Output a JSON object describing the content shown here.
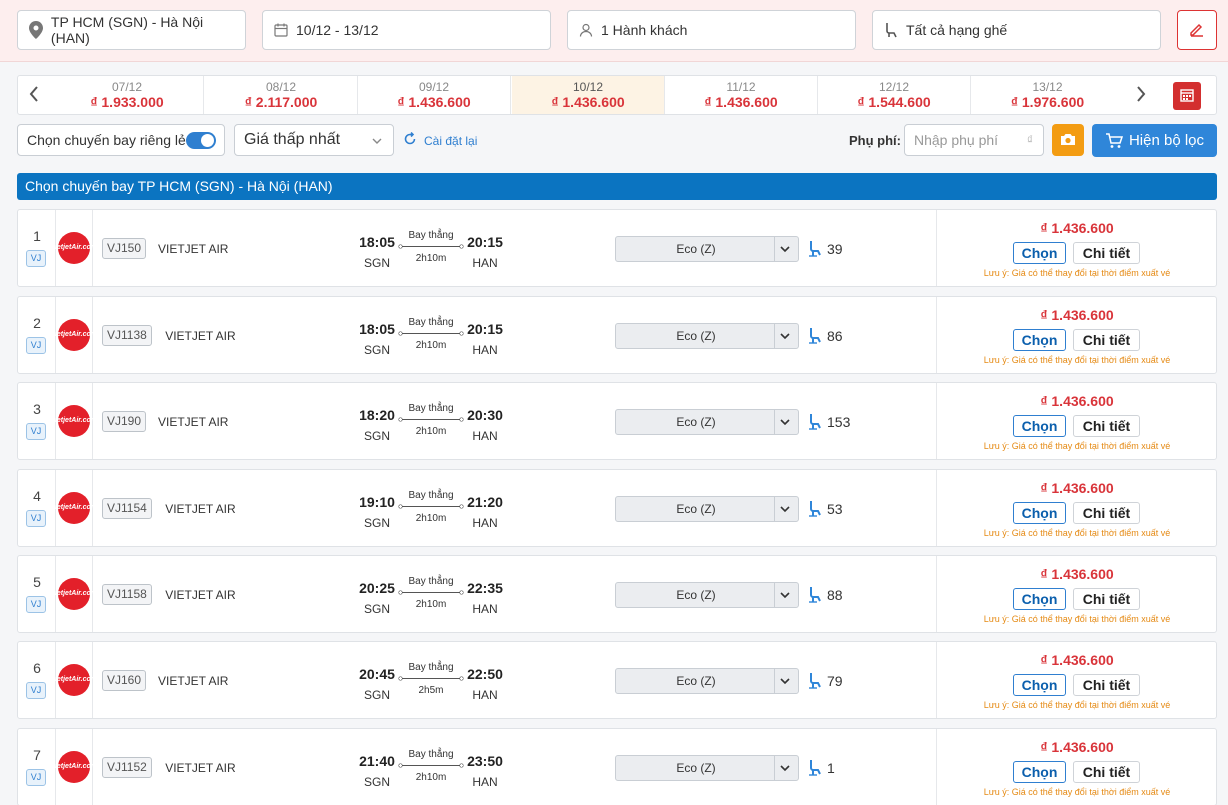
{
  "search": {
    "route": "TP HCM (SGN) - Hà Nội (HAN)",
    "dates": "10/12 - 13/12",
    "passengers": "1 Hành khách",
    "seat_class": "Tất cả hạng ghế"
  },
  "date_strip": [
    {
      "date": "07/12",
      "price": "₫ 1.933.000",
      "active": false
    },
    {
      "date": "08/12",
      "price": "₫ 2.117.000",
      "active": false
    },
    {
      "date": "09/12",
      "price": "₫ 1.436.600",
      "active": false
    },
    {
      "date": "10/12",
      "price": "₫ 1.436.600",
      "active": true
    },
    {
      "date": "11/12",
      "price": "₫ 1.436.600",
      "active": false
    },
    {
      "date": "12/12",
      "price": "₫ 1.544.600",
      "active": false
    },
    {
      "date": "13/12",
      "price": "₫ 1.976.600",
      "active": false
    }
  ],
  "filters": {
    "toggle_label": "Chọn chuyến bay riêng lẻ",
    "toggle_on": true,
    "sort_label": "Giá thấp nhất",
    "reset_label": "Cài đặt lại",
    "fee_label": "Phụ phí:",
    "fee_placeholder": "Nhập phụ phí",
    "fee_currency": "₫",
    "filter_button": "Hiện bộ lọc"
  },
  "section_title": "Chọn chuyến bay TP HCM (SGN) - Hà Nội (HAN)",
  "common": {
    "airline_badge": "VJ",
    "logo_text_1": "vietjet",
    "logo_text_2": "Air.com",
    "airline_name": "VIETJET AIR",
    "direct_label": "Bay thẳng",
    "from_code": "SGN",
    "to_code": "HAN",
    "class_label": "Eco  (Z)",
    "select_label": "Chọn",
    "detail_label": "Chi tiết",
    "note": "Lưu ý: Giá có thể thay đổi tại thời điểm xuất vé"
  },
  "flights": [
    {
      "index": "1",
      "code": "VJ150",
      "dep": "18:05",
      "arr": "20:15",
      "duration": "2h10m",
      "seats": "39",
      "price": "₫ 1.436.600"
    },
    {
      "index": "2",
      "code": "VJ1138",
      "dep": "18:05",
      "arr": "20:15",
      "duration": "2h10m",
      "seats": "86",
      "price": "₫ 1.436.600"
    },
    {
      "index": "3",
      "code": "VJ190",
      "dep": "18:20",
      "arr": "20:30",
      "duration": "2h10m",
      "seats": "153",
      "price": "₫ 1.436.600"
    },
    {
      "index": "4",
      "code": "VJ1154",
      "dep": "19:10",
      "arr": "21:20",
      "duration": "2h10m",
      "seats": "53",
      "price": "₫ 1.436.600"
    },
    {
      "index": "5",
      "code": "VJ1158",
      "dep": "20:25",
      "arr": "22:35",
      "duration": "2h10m",
      "seats": "88",
      "price": "₫ 1.436.600"
    },
    {
      "index": "6",
      "code": "VJ160",
      "dep": "20:45",
      "arr": "22:50",
      "duration": "2h5m",
      "seats": "79",
      "price": "₫ 1.436.600"
    },
    {
      "index": "7",
      "code": "VJ1152",
      "dep": "21:40",
      "arr": "23:50",
      "duration": "2h10m",
      "seats": "1",
      "price": "₫ 1.436.600"
    }
  ],
  "colors": {
    "price_red": "#d9343a",
    "primary_blue": "#2f86d9",
    "header_blue": "#0b74c1",
    "warn_orange": "#e58a14"
  }
}
